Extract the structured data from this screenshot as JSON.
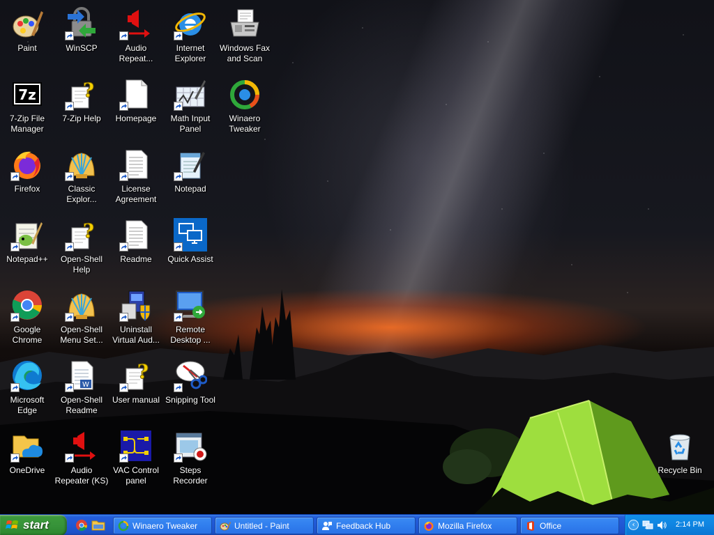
{
  "desktop": {
    "icons": [
      {
        "id": "paint",
        "label": "Paint",
        "shortcut": false
      },
      {
        "id": "winscp",
        "label": "WinSCP",
        "shortcut": true
      },
      {
        "id": "audio-repeater",
        "label": "Audio\nRepeat...",
        "shortcut": true
      },
      {
        "id": "internet-explorer",
        "label": "Internet\nExplorer",
        "shortcut": true
      },
      {
        "id": "windows-fax-scan",
        "label": "Windows Fax\nand Scan",
        "shortcut": false
      },
      {
        "id": "7zip-fm",
        "label": "7-Zip File\nManager",
        "shortcut": false
      },
      {
        "id": "7zip-help",
        "label": "7-Zip Help",
        "shortcut": true
      },
      {
        "id": "homepage",
        "label": "Homepage",
        "shortcut": true
      },
      {
        "id": "math-input",
        "label": "Math Input\nPanel",
        "shortcut": true
      },
      {
        "id": "winaero-tweaker",
        "label": "Winaero\nTweaker",
        "shortcut": false
      },
      {
        "id": "firefox",
        "label": "Firefox",
        "shortcut": true
      },
      {
        "id": "classic-explorer",
        "label": "Classic\nExplor...",
        "shortcut": true
      },
      {
        "id": "license-agreement",
        "label": "License\nAgreement",
        "shortcut": true
      },
      {
        "id": "notepad",
        "label": "Notepad",
        "shortcut": true
      },
      {
        "id": "notepadpp",
        "label": "Notepad++",
        "shortcut": true
      },
      {
        "id": "openshell-help",
        "label": "Open-Shell\nHelp",
        "shortcut": true
      },
      {
        "id": "readme",
        "label": "Readme",
        "shortcut": true
      },
      {
        "id": "quick-assist",
        "label": "Quick Assist",
        "shortcut": true
      },
      {
        "id": "chrome",
        "label": "Google\nChrome",
        "shortcut": true
      },
      {
        "id": "openshell-menu",
        "label": "Open-Shell\nMenu Set...",
        "shortcut": true
      },
      {
        "id": "uninstall-vac",
        "label": "Uninstall\nVirtual Aud...",
        "shortcut": true
      },
      {
        "id": "remote-desktop",
        "label": "Remote\nDesktop ...",
        "shortcut": true
      },
      {
        "id": "edge",
        "label": "Microsoft\nEdge",
        "shortcut": true
      },
      {
        "id": "openshell-readme",
        "label": "Open-Shell\nReadme",
        "shortcut": true
      },
      {
        "id": "user-manual",
        "label": "User manual",
        "shortcut": true
      },
      {
        "id": "snipping-tool",
        "label": "Snipping Tool",
        "shortcut": true
      },
      {
        "id": "onedrive",
        "label": "OneDrive",
        "shortcut": true
      },
      {
        "id": "audio-repeater-ks",
        "label": "Audio\nRepeater (KS)",
        "shortcut": true
      },
      {
        "id": "vac-control",
        "label": "VAC Control\npanel",
        "shortcut": true
      },
      {
        "id": "steps-recorder",
        "label": "Steps\nRecorder",
        "shortcut": true
      },
      {
        "id": "recycle-bin",
        "label": "Recycle Bin",
        "shortcut": false
      }
    ]
  },
  "taskbar": {
    "start_label": "start",
    "quick_launch": [
      "chrome-icon",
      "explorer-folder-icon"
    ],
    "tasks": [
      {
        "label": "Winaero Tweaker",
        "icon": "winaero-icon"
      },
      {
        "label": "Untitled - Paint",
        "icon": "paint-icon"
      },
      {
        "label": "Feedback Hub",
        "icon": "feedback-hub-icon"
      },
      {
        "label": "Mozilla Firefox",
        "icon": "firefox-icon"
      },
      {
        "label": "Office",
        "icon": "office-icon"
      }
    ],
    "tray": {
      "icons": [
        "network-icon",
        "volume-icon"
      ],
      "clock": "2:14 PM"
    }
  },
  "colors": {
    "taskbar_blue": "#245edb",
    "start_green": "#37933a",
    "tray_blue": "#0f84e1"
  }
}
